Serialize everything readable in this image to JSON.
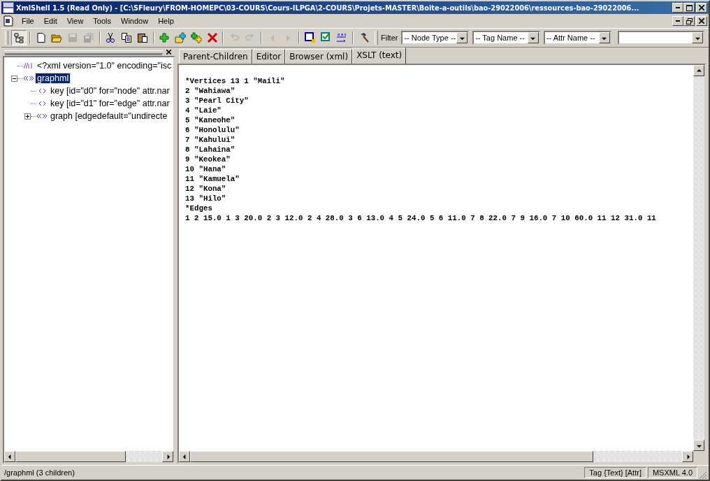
{
  "window": {
    "title": "XmlShell 1.5 (Read Only) - [C:\\SFleury\\FROM-HOMEPC\\03-COURS\\Cours-ILPGA\\2-COURS\\Projets-MASTER\\Boite-a-outils\\bao-29022006\\ressources-bao-29022006..."
  },
  "menu": [
    {
      "label": "File"
    },
    {
      "label": "Edit"
    },
    {
      "label": "View"
    },
    {
      "label": "Tools"
    },
    {
      "label": "Window"
    },
    {
      "label": "Help"
    }
  ],
  "toolbar": [
    {
      "kind": "tree",
      "disabled": false
    },
    {
      "kind": "sep"
    },
    {
      "kind": "new",
      "disabled": false
    },
    {
      "kind": "open",
      "disabled": false
    },
    {
      "kind": "save",
      "disabled": true
    },
    {
      "kind": "save-all",
      "disabled": true
    },
    {
      "kind": "sep"
    },
    {
      "kind": "cut",
      "disabled": false
    },
    {
      "kind": "copy",
      "disabled": false
    },
    {
      "kind": "paste",
      "disabled": false
    },
    {
      "kind": "sep"
    },
    {
      "kind": "add",
      "disabled": false
    },
    {
      "kind": "add-folder",
      "disabled": false
    },
    {
      "kind": "add-multi",
      "disabled": false
    },
    {
      "kind": "delete",
      "disabled": false
    },
    {
      "kind": "sep"
    },
    {
      "kind": "undo",
      "disabled": true
    },
    {
      "kind": "redo",
      "disabled": true
    },
    {
      "kind": "sep"
    },
    {
      "kind": "back",
      "disabled": true
    },
    {
      "kind": "forward",
      "disabled": true
    },
    {
      "kind": "sep"
    },
    {
      "kind": "check-w",
      "disabled": false
    },
    {
      "kind": "check-v",
      "disabled": false
    },
    {
      "kind": "xsl",
      "disabled": false
    },
    {
      "kind": "sep"
    },
    {
      "kind": "hammer",
      "disabled": false
    }
  ],
  "filter": {
    "label": "Filter",
    "dropdowns": [
      {
        "value": "-- Node Type --"
      },
      {
        "value": "-- Tag Name --"
      },
      {
        "value": "-- Attr Name --"
      }
    ]
  },
  "tree": [
    {
      "kind": "declaration",
      "label": "<?xml version=\"1.0\" encoding=\"isc",
      "selected": false
    },
    {
      "kind": "element",
      "label": "graphml",
      "selected": true,
      "expanded": true,
      "children": [
        {
          "kind": "leaf",
          "label": "key [id=\"d0\" for=\"node\" attr.nar",
          "selected": false
        },
        {
          "kind": "leaf",
          "label": "key [id=\"d1\" for=\"edge\" attr.nar",
          "selected": false
        },
        {
          "kind": "element",
          "label": "graph [edgedefault=\"undirecte",
          "selected": false,
          "expanded": false
        }
      ]
    }
  ],
  "tabs": [
    {
      "label": "Parent-Children",
      "selected": false
    },
    {
      "label": "Editor",
      "selected": false
    },
    {
      "label": "Browser (xml)",
      "selected": false
    },
    {
      "label": "XSLT (text)",
      "selected": true
    }
  ],
  "output_lines": [
    "*Vertices 13 1 \"Maili\"",
    "2 \"Wahiawa\"",
    "3 \"Pearl City\"",
    "4 \"Laie\"",
    "5 \"Kaneohe\"",
    "6 \"Honolulu\"",
    "7 \"Kahului\"",
    "8 \"Lahaina\"",
    "9 \"Keokea\"",
    "10 \"Hana\"",
    "11 \"Kamuela\"",
    "12 \"Kona\"",
    "13 \"Hilo\"",
    "*Edges",
    "1 2 15.0 1 3 20.0 2 3 12.0 2 4 28.0 3 6 13.0 4 5 24.0 5 6 11.0 7 8 22.0 7 9 16.0 7 10 60.0 11 12 31.0 11"
  ],
  "status_bar": {
    "path": "/graphml (3 children)",
    "panels": [
      "Tag {Text} [Attr]",
      "MSXML 4.0"
    ]
  }
}
